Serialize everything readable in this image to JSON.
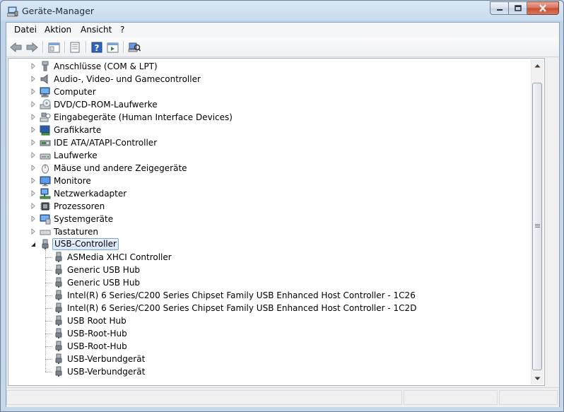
{
  "window": {
    "title": "Geräte-Manager"
  },
  "menu": [
    "Datei",
    "Aktion",
    "Ansicht",
    "?"
  ],
  "toolbar": {
    "buttons": [
      "back-icon",
      "forward-icon",
      "show-hide-console-tree-icon",
      "properties-icon",
      "help-icon",
      "run-icon",
      "scan-hardware-icon"
    ]
  },
  "tree": {
    "categories": [
      {
        "label": "Anschlüsse (COM & LPT)",
        "icon": "port-icon"
      },
      {
        "label": "Audio-, Video- und Gamecontroller",
        "icon": "speaker-icon"
      },
      {
        "label": "Computer",
        "icon": "computer-icon"
      },
      {
        "label": "DVD/CD-ROM-Laufwerke",
        "icon": "dvd-drive-icon"
      },
      {
        "label": "Eingabegeräte (Human Interface Devices)",
        "icon": "hid-icon"
      },
      {
        "label": "Grafikkarte",
        "icon": "display-adapter-icon"
      },
      {
        "label": "IDE ATA/ATAPI-Controller",
        "icon": "ide-controller-icon"
      },
      {
        "label": "Laufwerke",
        "icon": "disk-drive-icon"
      },
      {
        "label": "Mäuse und andere Zeigegeräte",
        "icon": "mouse-icon"
      },
      {
        "label": "Monitore",
        "icon": "monitor-icon"
      },
      {
        "label": "Netzwerkadapter",
        "icon": "network-adapter-icon"
      },
      {
        "label": "Prozessoren",
        "icon": "processor-icon"
      },
      {
        "label": "Systemgeräte",
        "icon": "system-device-icon"
      },
      {
        "label": "Tastaturen",
        "icon": "keyboard-icon"
      },
      {
        "label": "USB-Controller",
        "icon": "usb-icon"
      }
    ],
    "usb_children": [
      "ASMedia XHCI Controller",
      "Generic USB Hub",
      "Generic USB Hub",
      "Intel(R) 6 Series/C200 Series Chipset Family USB Enhanced Host Controller - 1C26",
      "Intel(R) 6 Series/C200 Series Chipset Family USB Enhanced Host Controller - 1C2D",
      "USB Root Hub",
      "USB-Root-Hub",
      "USB-Root-Hub",
      "USB-Verbundgerät",
      "USB-Verbundgerät"
    ]
  }
}
